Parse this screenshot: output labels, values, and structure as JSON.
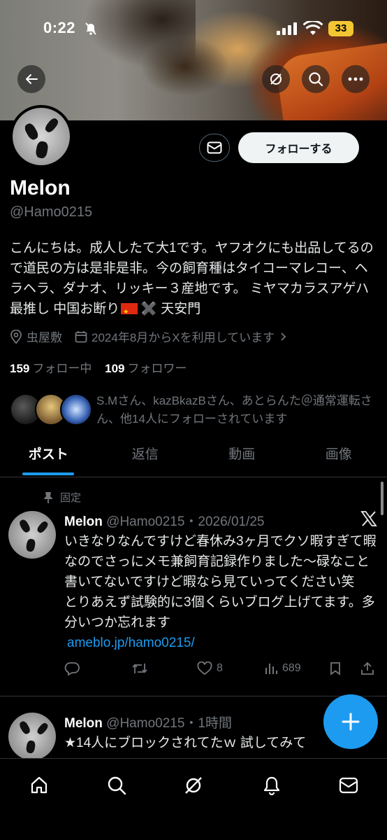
{
  "status_bar": {
    "time": "0:22",
    "battery": "33"
  },
  "profile": {
    "name": "Melon",
    "handle": "@Hamo0215",
    "bio": "こんにちは。成人したて大1です。ヤフオクにも出品してるので道民の方は是非是非。今の飼育種はタイコーマレコー、ヘラヘラ、ダナオ、リッキー３産地です。 ミヤマカラスアゲハ最推し 中国お断り",
    "bio_tail": "✖️ 天安門",
    "location": "虫屋敷",
    "joined": "2024年8月からXを利用しています",
    "following_count": "159",
    "following_label": "フォロー中",
    "followers_count": "109",
    "followers_label": "フォロワー",
    "followed_by": "S.Mさん、kazBkazBさん、あとらんた＠通常運転さん、他14人にフォローされています",
    "follow_button": "フォローする"
  },
  "tabs": [
    "ポスト",
    "返信",
    "動画",
    "画像"
  ],
  "posts": [
    {
      "pinned_label": "固定",
      "name": "Melon",
      "handle_time": "@Hamo0215・2026/01/25",
      "text": "いきなりなんですけど春休み3ヶ月でクソ暇すぎて暇なのでさっにメモ兼飼育記録作りました〜碌なこと書いてないですけど暇なら見ていってください笑　とりあえず試験的に3個くらいブログ上げてます。多分いつか忘れます",
      "link": "ameblo.jp/hamo0215/",
      "likes": "8",
      "views": "689"
    },
    {
      "name": "Melon",
      "handle_time": "@Hamo0215・1時間",
      "text": "★14人にブロックされてたｗ 試してみて"
    }
  ],
  "colors": {
    "accent": "#1d9bf0",
    "background": "#000000",
    "muted": "#71767b"
  },
  "icons": [
    "back-arrow-icon",
    "grok-icon",
    "search-icon",
    "more-icon",
    "mail-icon",
    "location-icon",
    "calendar-icon",
    "pin-icon",
    "x-logo-icon",
    "reply-icon",
    "retweet-icon",
    "like-icon",
    "views-icon",
    "bookmark-icon",
    "share-icon",
    "plus-icon",
    "home-icon",
    "notifications-icon"
  ]
}
